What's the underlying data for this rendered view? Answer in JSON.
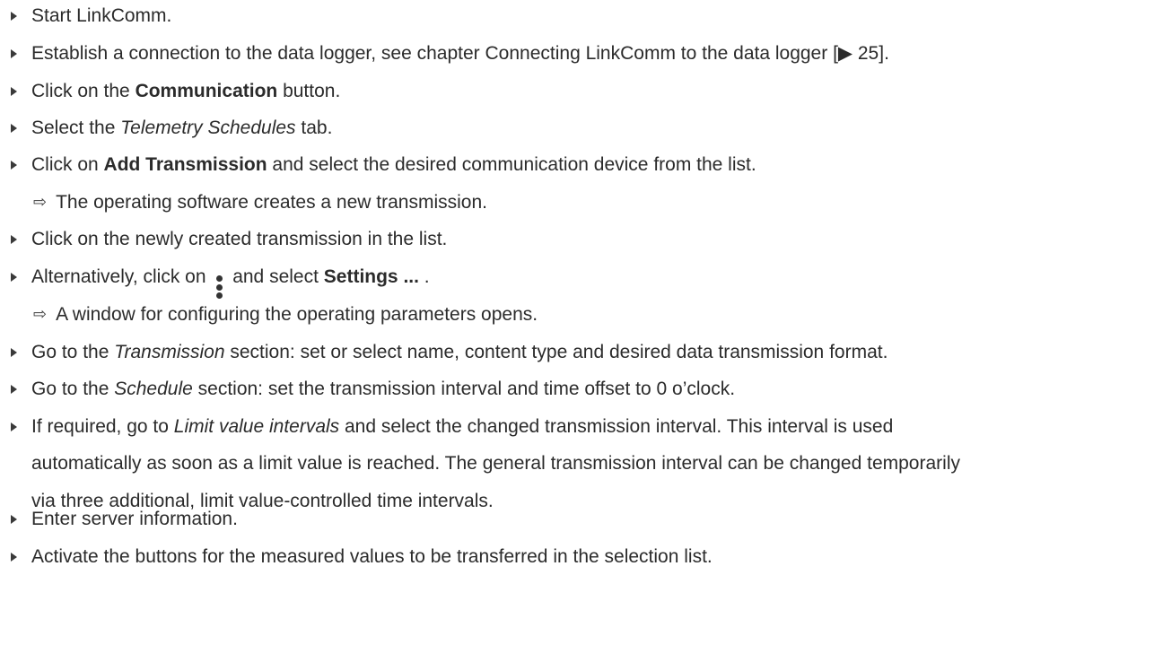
{
  "steps": [
    {
      "type": "step",
      "parts": [
        {
          "t": "Start LinkComm."
        }
      ]
    },
    {
      "type": "step",
      "parts": [
        {
          "t": "Establish a connection to the data logger, see chapter Connecting LinkComm to the data logger [▶ 25]."
        }
      ]
    },
    {
      "type": "step",
      "parts": [
        {
          "t": "Click on the "
        },
        {
          "b": "Communication"
        },
        {
          "t": " button."
        }
      ]
    },
    {
      "type": "step",
      "parts": [
        {
          "t": "Select the "
        },
        {
          "i": "Telemetry Schedules"
        },
        {
          "t": " tab."
        }
      ]
    },
    {
      "type": "step",
      "parts": [
        {
          "t": "Click on "
        },
        {
          "b": "Add Transmission"
        },
        {
          "t": " and select the desired communication device from the list."
        }
      ]
    },
    {
      "type": "result",
      "parts": [
        {
          "t": "The operating software creates a new transmission."
        }
      ]
    },
    {
      "type": "step",
      "parts": [
        {
          "t": "Click on the newly created transmission in the list."
        }
      ]
    },
    {
      "type": "step",
      "parts": [
        {
          "t": "Alternatively, click on "
        },
        {
          "icon": "more-vertical-icon"
        },
        {
          "t": " and select "
        },
        {
          "b": "Settings ..."
        },
        {
          "t": " ."
        }
      ]
    },
    {
      "type": "result",
      "parts": [
        {
          "t": "A window for configuring the operating parameters opens."
        }
      ]
    },
    {
      "type": "step",
      "parts": [
        {
          "t": "Go to the "
        },
        {
          "i": "Transmission"
        },
        {
          "t": " section: set or select name, content type and desired data transmission format."
        }
      ]
    },
    {
      "type": "step",
      "parts": [
        {
          "t": "Go to the "
        },
        {
          "i": "Schedule"
        },
        {
          "t": " section: set the transmission interval and time offset to 0 o’clock."
        }
      ]
    },
    {
      "type": "step",
      "lines": [
        [
          {
            "t": "If required, go to "
          },
          {
            "i": "Limit value intervals"
          },
          {
            "t": " and select the changed transmission interval. This interval is used"
          }
        ],
        [
          {
            "t": "automatically as soon as a limit value is reached. The general transmission interval can be changed temporarily"
          }
        ],
        [
          {
            "t": "via three additional, limit value-controlled time intervals."
          }
        ]
      ]
    },
    {
      "type": "step",
      "parts": [
        {
          "t": "Enter server information."
        }
      ]
    },
    {
      "type": "step",
      "parts": [
        {
          "t": "Activate the buttons for the measured values to be transferred in the selection list."
        }
      ]
    }
  ],
  "icons": {
    "step_marker": "triangle-right-icon",
    "result_marker": "outline-arrow-right-icon",
    "result_glyph": "⇨"
  }
}
